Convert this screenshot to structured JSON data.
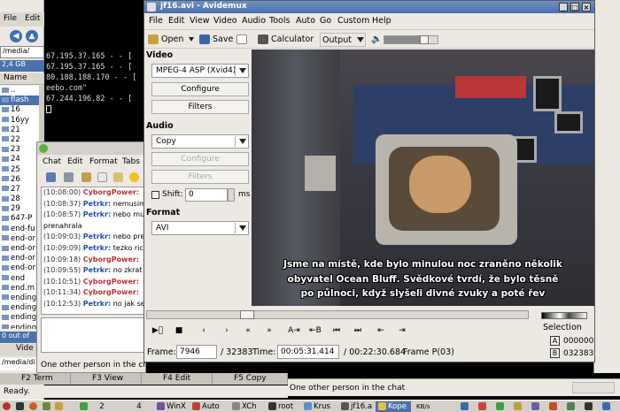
{
  "file_manager": {
    "menu": [
      "File",
      "Edit"
    ],
    "path": "/media/",
    "disk": "2,4 GB",
    "column": "Name",
    "entries": [
      "..",
      "flash",
      "16",
      "16yy",
      "21",
      "22",
      "23",
      "24",
      "25",
      "26",
      "27",
      "28",
      "29",
      "647-P",
      "end-fu",
      "end-or",
      "end-or",
      "end-or",
      "end-or",
      "end",
      "end.m",
      "ending",
      "ending",
      "ending",
      "ending"
    ],
    "selected_entry": "flash",
    "status": "0 out of",
    "vid_tab": "Vide",
    "bottom_path": "/media/di"
  },
  "terminal": {
    "lines": [
      "67.195.37.165 - - [",
      "67.195.37.165 - - [",
      "80.188.188.170 - - [",
      "eebo.com\"",
      "67.244.196.82 - - ["
    ]
  },
  "chat": {
    "menu": [
      "Chat",
      "Edit",
      "Format",
      "Tabs"
    ],
    "lines": [
      {
        "time": "(10:08:00)",
        "nick": "CyborgPower:",
        "msg": "",
        "kind": "a"
      },
      {
        "time": "(10:08:37)",
        "nick": "Petrkr:",
        "msg": "nemusim",
        "kind": "b"
      },
      {
        "time": "(10:08:57)",
        "nick": "Petrkr:",
        "msg": "nebo mu",
        "kind": "b"
      },
      {
        "time": "",
        "nick": "",
        "msg": "prenahrala",
        "kind": "plain"
      },
      {
        "time": "(10:09:03)",
        "nick": "Petrkr:",
        "msg": "nebo pre",
        "kind": "b"
      },
      {
        "time": "(10:09:09)",
        "nick": "Petrkr:",
        "msg": "tezko ric",
        "kind": "b"
      },
      {
        "time": "(10:09:18)",
        "nick": "CyborgPower:",
        "msg": "",
        "kind": "a"
      },
      {
        "time": "(10:09:55)",
        "nick": "Petrkr:",
        "msg": "no zkrat",
        "kind": "b"
      },
      {
        "time": "(10:10:51)",
        "nick": "CyborgPower:",
        "msg": "",
        "kind": "a"
      },
      {
        "time": "(10:11:34)",
        "nick": "CyborgPower:",
        "msg": "",
        "kind": "a"
      },
      {
        "time": "(10:12:53)",
        "nick": "Petrkr:",
        "msg": "no jak se",
        "kind": "b"
      }
    ],
    "status": "One other person in the chat"
  },
  "fkeys": [
    {
      "key": "F2",
      "label": "Term"
    },
    {
      "key": "F3",
      "label": "View"
    },
    {
      "key": "F4",
      "label": "Edit"
    },
    {
      "key": "F5",
      "label": "Copy"
    }
  ],
  "ready": "Ready.",
  "right_status": "One other person in the chat",
  "avidemux": {
    "title": "jf16.avi - Avidemux",
    "menu": [
      "File",
      "Edit",
      "View",
      "Video",
      "Audio",
      "Tools",
      "Auto",
      "Go",
      "Custom",
      "Help"
    ],
    "toolbar": {
      "open": "Open",
      "save": "Save",
      "calculator": "Calculator",
      "output": "Output",
      "volume_fraction": 0.75
    },
    "video": {
      "label": "Video",
      "codec": "MPEG-4 ASP (Xvid4)",
      "configure": "Configure",
      "filters": "Filters"
    },
    "audio": {
      "label": "Audio",
      "codec": "Copy",
      "configure": "Configure",
      "filters": "Filters",
      "shift_label": "Shift:",
      "shift_value": "0",
      "shift_unit": "ms"
    },
    "format": {
      "label": "Format",
      "value": "AVI"
    },
    "subtitles": [
      "Jsme na místě, kde bylo minulou noc zraněno několik",
      "obyvatel Ocean Bluff. Svědkové tvrdí, že bylo těsně",
      "po půlnoci, když slyšeli divné zvuky a poté řev"
    ],
    "selection": {
      "label": "Selection",
      "a_key": "A",
      "a_value": "000000",
      "b_key": "B",
      "b_value": "032383"
    },
    "status": {
      "frame_label": "Frame:",
      "frame_value": "7946",
      "frame_total": "/ 32383",
      "time_label": "Time:",
      "time_value": "00:05:31.414",
      "time_total": "/ 00:22:30.684",
      "frame_type": "Frame P(03)"
    },
    "timeline_fraction": 0.245
  },
  "taskbar": {
    "items": [
      "2",
      "4",
      "WinX",
      "Auto",
      "XCh",
      "root",
      "Krus",
      "jf16.a",
      "Kope"
    ],
    "active": "Kope",
    "clock": "KB/s"
  }
}
